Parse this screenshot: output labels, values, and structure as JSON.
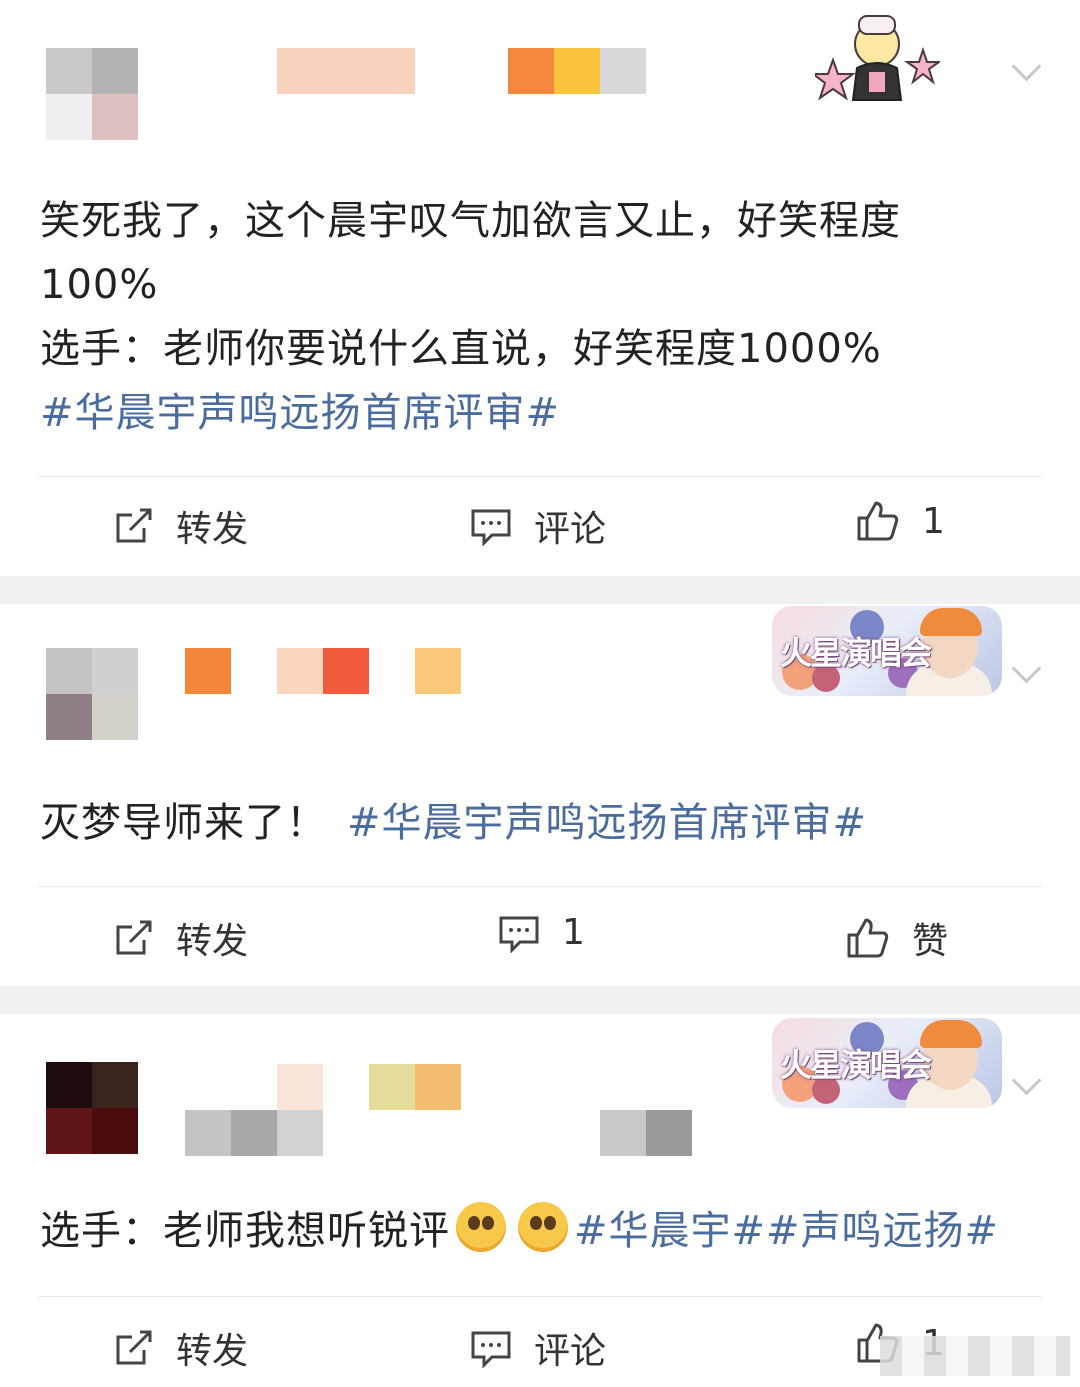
{
  "posts": [
    {
      "text_line1": "笑死我了，这个晨宇叹气加欲言又止，好笑程度",
      "text_line2": "100%",
      "text_line3": "选手：老师你要说什么直说，好笑程度1000%",
      "hashtag": "#华晨宇声鸣远扬首席评审#",
      "actions": {
        "repost": "转发",
        "comment": "评论",
        "like": "1"
      }
    },
    {
      "text": "灭梦导师来了！",
      "hashtag": "#华晨宇声鸣远扬首席评审#",
      "badge": "火星演唱会",
      "actions": {
        "repost": "转发",
        "comment": "1",
        "like": "赞"
      }
    },
    {
      "text": "选手：老师我想听锐评",
      "hashtag": "#华晨宇##声鸣远扬#",
      "badge": "火星演唱会",
      "actions": {
        "repost": "转发",
        "comment": "评论",
        "like": "1"
      }
    }
  ],
  "icons": {
    "repost": "repost-icon",
    "comment": "comment-icon",
    "like": "thumbs-up-icon",
    "more": "chevron-down-icon",
    "emoji": "pleading-face-emoji-icon"
  },
  "colors": {
    "hashtag": "#4b6c9e",
    "separator": "#f1f1f1"
  }
}
